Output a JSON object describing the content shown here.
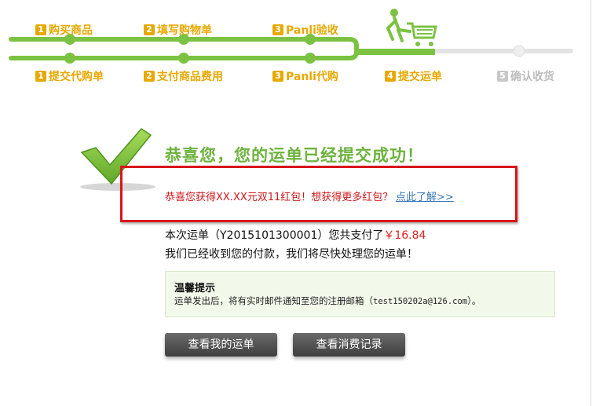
{
  "progress": {
    "top_steps": [
      {
        "num": "1",
        "label": "购买商品"
      },
      {
        "num": "2",
        "label": "填写购物单"
      },
      {
        "num": "3",
        "label": "Panli验收"
      }
    ],
    "bottom_steps": [
      {
        "num": "1",
        "label": "提交代购单"
      },
      {
        "num": "2",
        "label": "支付商品费用"
      },
      {
        "num": "3",
        "label": "Panli代购"
      },
      {
        "num": "4",
        "label": "提交运单"
      },
      {
        "num": "5",
        "label": "确认收货"
      }
    ],
    "active_color": "#7cc242",
    "inactive_color": "#e3e3e3"
  },
  "success": {
    "title": "恭喜您，您的运单已经提交成功！",
    "promo_text": "恭喜您获得XX.XX元双11红包！想获得更多红包？",
    "promo_link": "点此了解>>",
    "pay_prefix": "本次运单（Y2015101300001）您共支付了",
    "pay_amount": "￥16.84",
    "received_text": "我们已经收到您的付款，我们将尽快处理您的运单！"
  },
  "tip": {
    "title": "温馨提示",
    "text_prefix": "运单发出后，将有实时邮件通知至您的注册邮箱（",
    "email": "test150202a@126.com",
    "text_suffix": "）。"
  },
  "buttons": {
    "view_waybill": "查看我的运单",
    "view_records": "查看消费记录"
  }
}
